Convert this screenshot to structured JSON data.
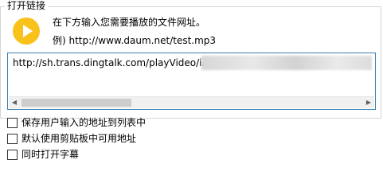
{
  "dialog": {
    "group_title": "打开链接",
    "prompt": "在下方输入您需要播放的文件网址。",
    "example": "例) http://www.daum.net/test.mp3",
    "url_value": "http://sh.trans.dingtalk.com/playVideo/iA",
    "icons": {
      "play": "play-icon",
      "scroll_left": "chevron-left-icon",
      "scroll_right": "chevron-right-icon"
    },
    "options": [
      {
        "label": "保存用户输入的地址到列表中",
        "checked": false
      },
      {
        "label": "默认使用剪贴板中可用地址",
        "checked": false
      },
      {
        "label": "同时打开字幕",
        "checked": false
      }
    ],
    "accent_color": "#f8c21a",
    "focus_border_color": "#3c7fb1"
  }
}
